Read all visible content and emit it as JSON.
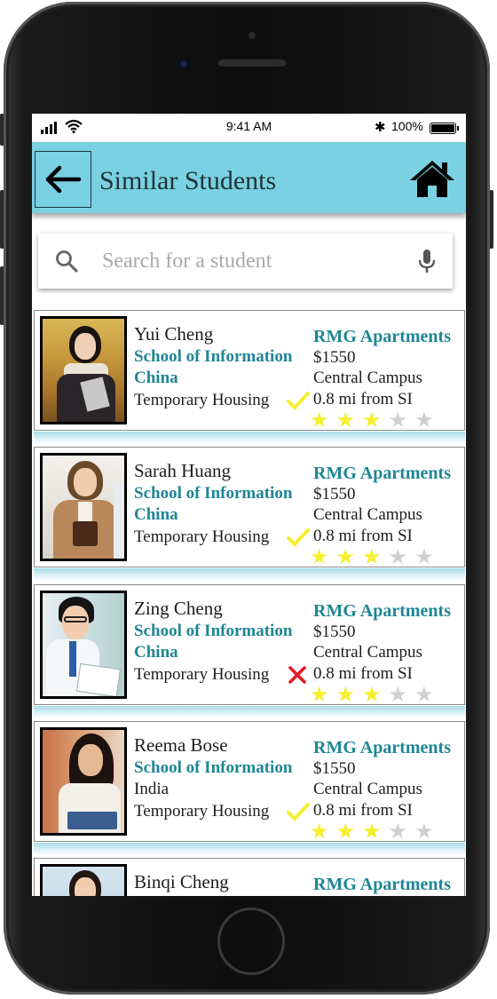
{
  "status_bar": {
    "time": "9:41 AM",
    "battery_percent": "100%",
    "bluetooth_icon": "bluetooth-icon",
    "wifi_icon": "wifi-icon"
  },
  "header": {
    "title": "Similar Students",
    "back_icon": "arrow-left-icon",
    "home_icon": "home-icon",
    "background": "#7ad1e1"
  },
  "search": {
    "placeholder": "Search for a student",
    "search_icon": "search-icon",
    "mic_icon": "microphone-icon"
  },
  "colors": {
    "accent": "#1e8694",
    "star_on": "#f5ef2f",
    "star_off": "#d0d0d0",
    "check": "#f5ef2f",
    "cross": "#e31b23"
  },
  "students": [
    {
      "name": "Yui Cheng",
      "school": "School of Information",
      "country": "China",
      "housing": "Temporary Housing",
      "housing_status": "check",
      "apartment": "RMG Apartments",
      "price": "$1550",
      "campus": "Central Campus",
      "distance": "0.8 mi from SI",
      "rating": 3,
      "rating_max": 5
    },
    {
      "name": "Sarah Huang",
      "school": "School of Information",
      "country": "China",
      "housing": "Temporary Housing",
      "housing_status": "check",
      "apartment": "RMG Apartments",
      "price": "$1550",
      "campus": "Central Campus",
      "distance": "0.8 mi from SI",
      "rating": 3,
      "rating_max": 5
    },
    {
      "name": "Zing Cheng",
      "school": "School of Information",
      "country": "China",
      "housing": "Temporary Housing",
      "housing_status": "cross",
      "apartment": "RMG Apartments",
      "price": "$1550",
      "campus": "Central Campus",
      "distance": "0.8 mi from SI",
      "rating": 3,
      "rating_max": 5
    },
    {
      "name": "Reema Bose",
      "school": "School of Information",
      "country": "India",
      "housing": "Temporary Housing",
      "housing_status": "check",
      "apartment": "RMG Apartments",
      "price": "$1550",
      "campus": "Central Campus",
      "distance": "0.8 mi from SI",
      "rating": 3,
      "rating_max": 5
    },
    {
      "name": "Binqi Cheng",
      "apartment": "RMG Apartments"
    }
  ]
}
